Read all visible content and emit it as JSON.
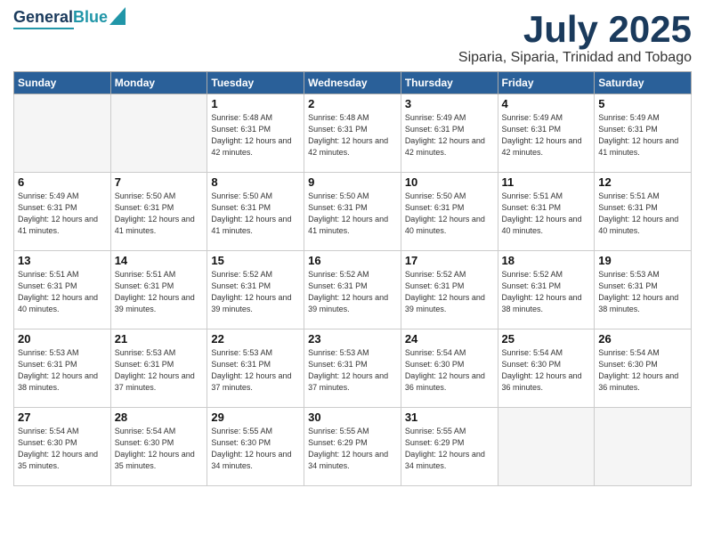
{
  "logo": {
    "line1": "General",
    "line2": "Blue"
  },
  "header": {
    "month": "July 2025",
    "location": "Siparia, Siparia, Trinidad and Tobago"
  },
  "days_of_week": [
    "Sunday",
    "Monday",
    "Tuesday",
    "Wednesday",
    "Thursday",
    "Friday",
    "Saturday"
  ],
  "weeks": [
    [
      {
        "day": "",
        "info": ""
      },
      {
        "day": "",
        "info": ""
      },
      {
        "day": "1",
        "info": "Sunrise: 5:48 AM\nSunset: 6:31 PM\nDaylight: 12 hours and 42 minutes."
      },
      {
        "day": "2",
        "info": "Sunrise: 5:48 AM\nSunset: 6:31 PM\nDaylight: 12 hours and 42 minutes."
      },
      {
        "day": "3",
        "info": "Sunrise: 5:49 AM\nSunset: 6:31 PM\nDaylight: 12 hours and 42 minutes."
      },
      {
        "day": "4",
        "info": "Sunrise: 5:49 AM\nSunset: 6:31 PM\nDaylight: 12 hours and 42 minutes."
      },
      {
        "day": "5",
        "info": "Sunrise: 5:49 AM\nSunset: 6:31 PM\nDaylight: 12 hours and 41 minutes."
      }
    ],
    [
      {
        "day": "6",
        "info": "Sunrise: 5:49 AM\nSunset: 6:31 PM\nDaylight: 12 hours and 41 minutes."
      },
      {
        "day": "7",
        "info": "Sunrise: 5:50 AM\nSunset: 6:31 PM\nDaylight: 12 hours and 41 minutes."
      },
      {
        "day": "8",
        "info": "Sunrise: 5:50 AM\nSunset: 6:31 PM\nDaylight: 12 hours and 41 minutes."
      },
      {
        "day": "9",
        "info": "Sunrise: 5:50 AM\nSunset: 6:31 PM\nDaylight: 12 hours and 41 minutes."
      },
      {
        "day": "10",
        "info": "Sunrise: 5:50 AM\nSunset: 6:31 PM\nDaylight: 12 hours and 40 minutes."
      },
      {
        "day": "11",
        "info": "Sunrise: 5:51 AM\nSunset: 6:31 PM\nDaylight: 12 hours and 40 minutes."
      },
      {
        "day": "12",
        "info": "Sunrise: 5:51 AM\nSunset: 6:31 PM\nDaylight: 12 hours and 40 minutes."
      }
    ],
    [
      {
        "day": "13",
        "info": "Sunrise: 5:51 AM\nSunset: 6:31 PM\nDaylight: 12 hours and 40 minutes."
      },
      {
        "day": "14",
        "info": "Sunrise: 5:51 AM\nSunset: 6:31 PM\nDaylight: 12 hours and 39 minutes."
      },
      {
        "day": "15",
        "info": "Sunrise: 5:52 AM\nSunset: 6:31 PM\nDaylight: 12 hours and 39 minutes."
      },
      {
        "day": "16",
        "info": "Sunrise: 5:52 AM\nSunset: 6:31 PM\nDaylight: 12 hours and 39 minutes."
      },
      {
        "day": "17",
        "info": "Sunrise: 5:52 AM\nSunset: 6:31 PM\nDaylight: 12 hours and 39 minutes."
      },
      {
        "day": "18",
        "info": "Sunrise: 5:52 AM\nSunset: 6:31 PM\nDaylight: 12 hours and 38 minutes."
      },
      {
        "day": "19",
        "info": "Sunrise: 5:53 AM\nSunset: 6:31 PM\nDaylight: 12 hours and 38 minutes."
      }
    ],
    [
      {
        "day": "20",
        "info": "Sunrise: 5:53 AM\nSunset: 6:31 PM\nDaylight: 12 hours and 38 minutes."
      },
      {
        "day": "21",
        "info": "Sunrise: 5:53 AM\nSunset: 6:31 PM\nDaylight: 12 hours and 37 minutes."
      },
      {
        "day": "22",
        "info": "Sunrise: 5:53 AM\nSunset: 6:31 PM\nDaylight: 12 hours and 37 minutes."
      },
      {
        "day": "23",
        "info": "Sunrise: 5:53 AM\nSunset: 6:31 PM\nDaylight: 12 hours and 37 minutes."
      },
      {
        "day": "24",
        "info": "Sunrise: 5:54 AM\nSunset: 6:30 PM\nDaylight: 12 hours and 36 minutes."
      },
      {
        "day": "25",
        "info": "Sunrise: 5:54 AM\nSunset: 6:30 PM\nDaylight: 12 hours and 36 minutes."
      },
      {
        "day": "26",
        "info": "Sunrise: 5:54 AM\nSunset: 6:30 PM\nDaylight: 12 hours and 36 minutes."
      }
    ],
    [
      {
        "day": "27",
        "info": "Sunrise: 5:54 AM\nSunset: 6:30 PM\nDaylight: 12 hours and 35 minutes."
      },
      {
        "day": "28",
        "info": "Sunrise: 5:54 AM\nSunset: 6:30 PM\nDaylight: 12 hours and 35 minutes."
      },
      {
        "day": "29",
        "info": "Sunrise: 5:55 AM\nSunset: 6:30 PM\nDaylight: 12 hours and 34 minutes."
      },
      {
        "day": "30",
        "info": "Sunrise: 5:55 AM\nSunset: 6:29 PM\nDaylight: 12 hours and 34 minutes."
      },
      {
        "day": "31",
        "info": "Sunrise: 5:55 AM\nSunset: 6:29 PM\nDaylight: 12 hours and 34 minutes."
      },
      {
        "day": "",
        "info": ""
      },
      {
        "day": "",
        "info": ""
      }
    ]
  ]
}
